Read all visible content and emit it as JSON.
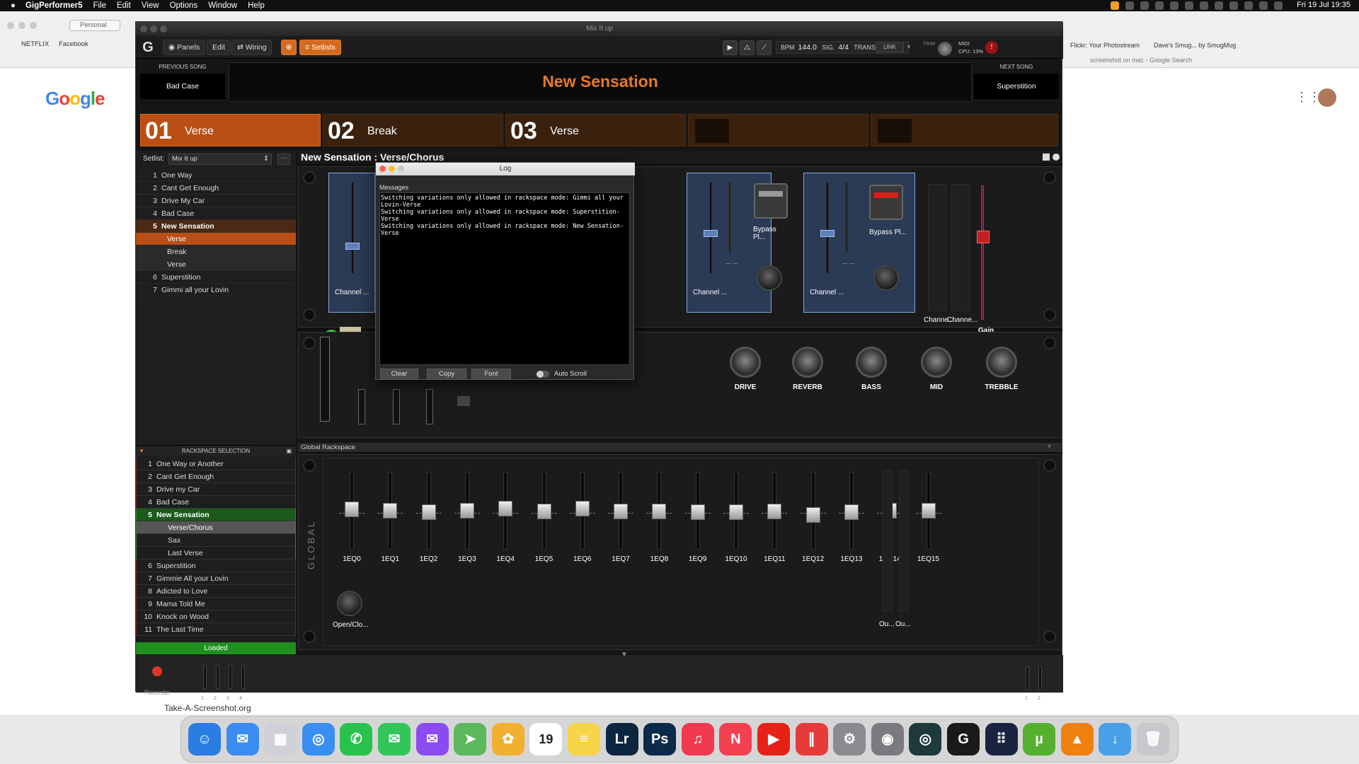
{
  "menubar": {
    "app": "GigPerformer5",
    "items": [
      "File",
      "Edit",
      "View",
      "Options",
      "Window",
      "Help"
    ],
    "datetime": "Fri 19 Jul 19:35"
  },
  "browser": {
    "profile": "Personal",
    "bookmarks": [
      "NETFLIX",
      "Facebook"
    ],
    "right_tabs": [
      "Flickr: Your Photostream",
      "Dave's Smug... by SmugMug"
    ],
    "search_hint": "screenshot on mac - Google Search",
    "logo": "Google",
    "footer": "Take-A-Screenshot.org"
  },
  "window": {
    "title": "Mix It up"
  },
  "toolbar": {
    "panels": "Panels",
    "edit": "Edit",
    "wiring": "Wiring",
    "setlists": "Setlists",
    "bpm_label": "BPM",
    "bpm": "144.0",
    "sig_label": "SIG.",
    "sig": "4/4",
    "trans_label": "TRANS.",
    "trans": "0",
    "link": "LINK",
    "trim": "TRIM",
    "midi": "MIDI",
    "cpu": "CPU: 13%"
  },
  "songs": {
    "prev_label": "PREVIOUS SONG",
    "prev": "Bad Case",
    "title": "New Sensation",
    "next_label": "NEXT SONG",
    "next": "Superstition"
  },
  "parts": [
    {
      "num": "01",
      "name": "Verse",
      "active": true
    },
    {
      "num": "02",
      "name": "Break"
    },
    {
      "num": "03",
      "name": "Verse"
    }
  ],
  "setlist": {
    "label": "Setlist:",
    "selected": "Mix It up",
    "more": "···",
    "items": [
      {
        "n": "1",
        "t": "One Way"
      },
      {
        "n": "2",
        "t": "Cant Get Enough"
      },
      {
        "n": "3",
        "t": "Drive My Car"
      },
      {
        "n": "4",
        "t": "Bad Case"
      },
      {
        "n": "5",
        "t": "New Sensation",
        "kind": "song-active"
      },
      {
        "t": "Verse",
        "kind": "sub active"
      },
      {
        "t": "Break",
        "kind": "sub"
      },
      {
        "t": "Verse",
        "kind": "sub"
      },
      {
        "n": "6",
        "t": "Superstition"
      },
      {
        "n": "7",
        "t": "Gimmi all your Lovin"
      }
    ]
  },
  "rackspace": {
    "header": "RACKSPACE SELECTION",
    "items": [
      {
        "n": "1",
        "t": "One Way or Another"
      },
      {
        "n": "2",
        "t": "Cant Get Enough"
      },
      {
        "n": "3",
        "t": "Drive my Car"
      },
      {
        "n": "4",
        "t": "Bad Case"
      },
      {
        "n": "5",
        "t": "New Sensation",
        "kind": "song-green"
      },
      {
        "t": "Verse/Chorus",
        "kind": "sub active"
      },
      {
        "t": "Sax",
        "kind": "sub"
      },
      {
        "t": "Last Verse",
        "kind": "sub"
      },
      {
        "n": "6",
        "t": "Superstition"
      },
      {
        "n": "7",
        "t": "Gimmie All your Lovin"
      },
      {
        "n": "8",
        "t": "Adicted to Love"
      },
      {
        "n": "9",
        "t": "Mama Told Me"
      },
      {
        "n": "10",
        "t": "Knock on Wood"
      },
      {
        "n": "11",
        "t": "The Last Time"
      }
    ],
    "status": "Loaded"
  },
  "rack": {
    "title": "New Sensation : Verse/Chorus",
    "strip_labels": [
      "Channel ...",
      "Channel ...",
      "Channel ..."
    ],
    "bypass_label": "Bypass Pl...",
    "dots": "... ...",
    "meters": [
      "Channe...",
      "Channe..."
    ],
    "gain": "Gain",
    "knobs": [
      "DRIVE",
      "REVERB",
      "BASS",
      "MID",
      "TREBBLE"
    ]
  },
  "log": {
    "title": "Log",
    "header": "Messages",
    "lines": [
      "Switching variations only allowed in rackspace mode: Gimmi all your Lovin-Verse",
      "Switching variations only allowed in rackspace mode: Superstition-Verse",
      "Switching variations only allowed in rackspace mode: New Sensation-Verse"
    ],
    "clear": "Clear",
    "copy": "Copy",
    "font": "Font",
    "autoscroll": "Auto Scroll"
  },
  "global": {
    "header": "Global Rackspace",
    "side": "GLOBAL",
    "eq": [
      "1EQ0",
      "1EQ1",
      "1EQ2",
      "1EQ3",
      "1EQ4",
      "1EQ5",
      "1EQ6",
      "1EQ7",
      "1EQ8",
      "1EQ9",
      "1EQ10",
      "1EQ11",
      "1EQ12",
      "1EQ13",
      "1EQ14",
      "1EQ15"
    ],
    "eq_levels": [
      0.52,
      0.5,
      0.48,
      0.5,
      0.53,
      0.49,
      0.53,
      0.49,
      0.49,
      0.48,
      0.48,
      0.49,
      0.45,
      0.48,
      0.5,
      0.5
    ],
    "openclose": "Open/Clo...",
    "outs": [
      "Ou...",
      "Ou..."
    ]
  },
  "bottom": {
    "recorder": "Recorder",
    "channels": [
      "1",
      "2",
      "3",
      "4"
    ],
    "outputs": [
      "1",
      "2"
    ]
  },
  "dock": [
    {
      "name": "Finder",
      "color": "#2a7de1",
      "g": "☺"
    },
    {
      "name": "Mail",
      "color": "#3b8cf0",
      "g": "✉"
    },
    {
      "name": "Launchpad",
      "color": "#d0d0d8",
      "g": "▦"
    },
    {
      "name": "Safari",
      "color": "#3a8ef0",
      "g": "◎"
    },
    {
      "name": "WhatsApp",
      "color": "#29c24d",
      "g": "✆"
    },
    {
      "name": "Messages",
      "color": "#32c65a",
      "g": "✉"
    },
    {
      "name": "Messenger",
      "color": "#8a4bf0",
      "g": "✉"
    },
    {
      "name": "Maps",
      "color": "#5cb85c",
      "g": "➤"
    },
    {
      "name": "Photos",
      "color": "#f2b030",
      "g": "✿"
    },
    {
      "name": "Calendar",
      "color": "#ffffff",
      "g": "19"
    },
    {
      "name": "Notes",
      "color": "#f6d54a",
      "g": "≡"
    },
    {
      "name": "Lightroom",
      "color": "#0c2640",
      "g": "Lr"
    },
    {
      "name": "Photoshop",
      "color": "#0c2a4a",
      "g": "Ps"
    },
    {
      "name": "Music",
      "color": "#f03850",
      "g": "♫"
    },
    {
      "name": "News",
      "color": "#f24050",
      "g": "N"
    },
    {
      "name": "YouTube",
      "color": "#e62117",
      "g": "▶"
    },
    {
      "name": "Parallels",
      "color": "#e63b3b",
      "g": "∥"
    },
    {
      "name": "Settings",
      "color": "#8a8a90",
      "g": "⚙"
    },
    {
      "name": "Disk Utility",
      "color": "#7a7a80",
      "g": "◉"
    },
    {
      "name": "Camo",
      "color": "#1e3a3a",
      "g": "◎"
    },
    {
      "name": "GigPerformer",
      "color": "#1a1a1a",
      "g": "G"
    },
    {
      "name": "Dots",
      "color": "#1a2440",
      "g": "⠿"
    },
    {
      "name": "uTorrent",
      "color": "#55b030",
      "g": "µ"
    },
    {
      "name": "VLC",
      "color": "#f08010",
      "g": "▲"
    },
    {
      "name": "Downloads",
      "color": "#4aa0e8",
      "g": "↓"
    },
    {
      "name": "Trash",
      "color": "#c8c8cc",
      "g": "🗑"
    }
  ]
}
